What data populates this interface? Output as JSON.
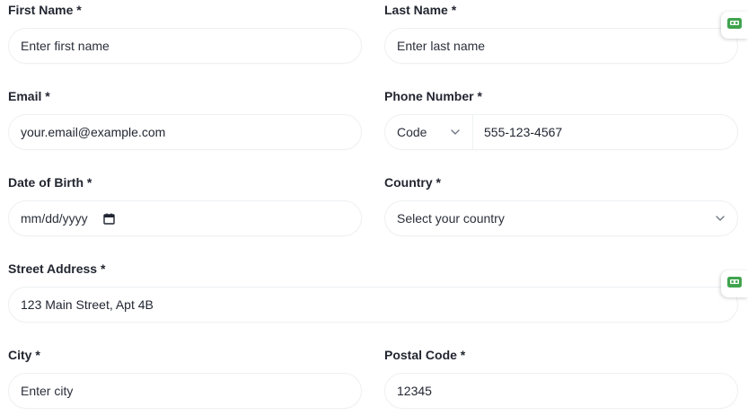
{
  "form": {
    "first_name": {
      "label": "First Name *",
      "placeholder": "Enter first name"
    },
    "last_name": {
      "label": "Last Name *",
      "placeholder": "Enter last name"
    },
    "email": {
      "label": "Email *",
      "value": "your.email@example.com"
    },
    "phone": {
      "label": "Phone Number *",
      "code_placeholder": "Code",
      "value": "555-123-4567"
    },
    "dob": {
      "label": "Date of Birth *",
      "placeholder": "mm/dd/yyyy"
    },
    "country": {
      "label": "Country *",
      "placeholder": "Select your country"
    },
    "street": {
      "label": "Street Address *",
      "value": "123 Main Street, Apt 4B"
    },
    "city": {
      "label": "City *",
      "placeholder": "Enter city"
    },
    "postal": {
      "label": "Postal Code *",
      "value": "12345"
    }
  },
  "extension_badge": {
    "icon": "password-manager-icon",
    "color": "#3fa34d"
  }
}
